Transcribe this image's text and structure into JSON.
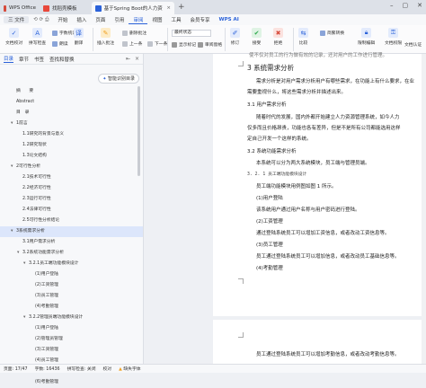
{
  "tabs": [
    {
      "label": "WPS Office",
      "color": "#d64a3b"
    },
    {
      "label": "找稻壳模板",
      "color": "#e8483b"
    },
    {
      "label": "基于Spring Boot的人力资源管",
      "color": "#2b62d9"
    }
  ],
  "menu": {
    "file": "三 文件",
    "items": [
      "开始",
      "插入",
      "页面",
      "引用",
      "审阅",
      "视图",
      "工具",
      "会员专享"
    ],
    "active": "审阅",
    "ai": "WPS AI"
  },
  "ribbon": {
    "buttons": [
      {
        "label": "文档校对",
        "icon": "check-icon",
        "color": "#2b62d9"
      },
      {
        "label": "拼写检查",
        "icon": "spell-icon",
        "color": "#2b62d9"
      },
      {
        "label": "翻译",
        "icon": "translate-icon",
        "color": "#2b62d9"
      },
      {
        "label": "插入批注",
        "icon": "comment-icon",
        "color": "#f0a020"
      },
      {
        "label": "显示标记",
        "icon": "mark-icon",
        "color": "#555"
      },
      {
        "label": "修订",
        "icon": "revision-icon",
        "color": "#2b62d9"
      },
      {
        "label": "接受",
        "icon": "accept-icon",
        "color": "#2ba84a"
      },
      {
        "label": "拒绝",
        "icon": "reject-icon",
        "color": "#d64a3b"
      },
      {
        "label": "比较",
        "icon": "compare-icon",
        "color": "#2b62d9"
      },
      {
        "label": "限制编辑",
        "icon": "restrict-icon",
        "color": "#2b62d9"
      },
      {
        "label": "文档权限",
        "icon": "permission-icon",
        "color": "#2b62d9"
      }
    ],
    "small": [
      "字数统计",
      "朗读",
      "简繁转换",
      "删除批注",
      "上一条",
      "下一条",
      "审阅",
      "最终状态",
      "显示标记",
      "审阅窗格",
      "文档认证"
    ],
    "status_select": "最终状态"
  },
  "nav": {
    "tabs": [
      "目录",
      "章节",
      "书签",
      "查找和替换"
    ],
    "active_tab": "目录",
    "smart_button": "智能识别目录",
    "toc": [
      {
        "label": "摘　　要",
        "indent": 0,
        "arrow": false,
        "selected": false
      },
      {
        "label": "Abstract",
        "indent": 0,
        "arrow": false,
        "selected": false
      },
      {
        "label": "目　录",
        "indent": 0,
        "arrow": false,
        "selected": false
      },
      {
        "label": "1前言",
        "indent": 0,
        "arrow": true,
        "selected": false
      },
      {
        "label": "1.1研究的背景与意义",
        "indent": 1,
        "arrow": false,
        "selected": false
      },
      {
        "label": "1.2研究现状",
        "indent": 1,
        "arrow": false,
        "selected": false
      },
      {
        "label": "1.3论文结构",
        "indent": 1,
        "arrow": false,
        "selected": false
      },
      {
        "label": "2可行性分析",
        "indent": 0,
        "arrow": true,
        "selected": false
      },
      {
        "label": "2.1技术可行性",
        "indent": 1,
        "arrow": false,
        "selected": false
      },
      {
        "label": "2.2经济可行性",
        "indent": 1,
        "arrow": false,
        "selected": false
      },
      {
        "label": "2.3运行可行性",
        "indent": 1,
        "arrow": false,
        "selected": false
      },
      {
        "label": "2.4法律可行性",
        "indent": 1,
        "arrow": false,
        "selected": false
      },
      {
        "label": "2.5可行性分析结论",
        "indent": 1,
        "arrow": false,
        "selected": false
      },
      {
        "label": "3系统需求分析",
        "indent": 0,
        "arrow": true,
        "selected": true
      },
      {
        "label": "3.1用户需求分析",
        "indent": 1,
        "arrow": false,
        "selected": false
      },
      {
        "label": "3.2系统功能需求分析",
        "indent": 1,
        "arrow": true,
        "selected": false
      },
      {
        "label": "3.2.1员工端功能模块设计",
        "indent": 2,
        "arrow": true,
        "selected": false
      },
      {
        "label": "(1)用户登陆",
        "indent": 3,
        "arrow": false,
        "selected": false
      },
      {
        "label": "(2)工资管理",
        "indent": 3,
        "arrow": false,
        "selected": false
      },
      {
        "label": "(3)员工管理",
        "indent": 3,
        "arrow": false,
        "selected": false
      },
      {
        "label": "(4)考勤管理",
        "indent": 3,
        "arrow": false,
        "selected": false
      },
      {
        "label": "3.2.2管理员端功能模块设计",
        "indent": 2,
        "arrow": true,
        "selected": false
      },
      {
        "label": "(1)用户登陆",
        "indent": 3,
        "arrow": false,
        "selected": false
      },
      {
        "label": "(2)管理员管理",
        "indent": 3,
        "arrow": false,
        "selected": false
      },
      {
        "label": "(3)工资管理",
        "indent": 3,
        "arrow": false,
        "selected": false
      },
      {
        "label": "(4)员工管理",
        "indent": 3,
        "arrow": false,
        "selected": false
      },
      {
        "label": "(5)文档管理",
        "indent": 3,
        "arrow": false,
        "selected": false
      },
      {
        "label": "(6)考勤管理",
        "indent": 3,
        "arrow": false,
        "selected": false
      }
    ]
  },
  "doc": {
    "top_line": "使不仅对员工的行为做有效的记录，还对用户的工作进行管理。",
    "chapter": "3 系统需求分析",
    "p1a": "需求分析是对用户需求分析用户有哪些需求，在功能上有什么要求，在业",
    "p1b": "需要重视什么，将这些需求分析并描述出来。",
    "s31": "3.1  用户需求分析",
    "p2a": "随着时代的发展，国内外都开始建立人力资源管理系统，如今人力",
    "p2b": "仅多而且价格昂贵，功能也各有差异，但是不是所有公司都能选用这样",
    "p2c": "定自己开发一个这样的系统。",
    "s32": "3.2  系统功能需求分析",
    "p3": "本系统可以分为两大系统模块，员工端与管理员端。",
    "s321": "3. 2. 1  员工端功能模块设计",
    "p4": "员工端功能模块用例图如图 1 所示。",
    "items": [
      "(1)用户登陆",
      "该系统用户通过用户名称与用户密码进行登陆。",
      "(2)工资管理",
      "通过登陆系统员工可以增加工资信息，或者改动工资信息等。",
      "(3)员工管理",
      "员工通过登陆系统员工可以增加信息，或者改动员工基础信息等。",
      "(4)考勤管理"
    ],
    "page2_line": "员工通过登陆系统员工可以增加考勤信息，或者改动考勤信息等。"
  },
  "status": {
    "page": "页面: 17/47",
    "words": "字数: 16436",
    "spell": "拼写检查: 关闭",
    "proof": "校对",
    "font": "缺失字体"
  }
}
